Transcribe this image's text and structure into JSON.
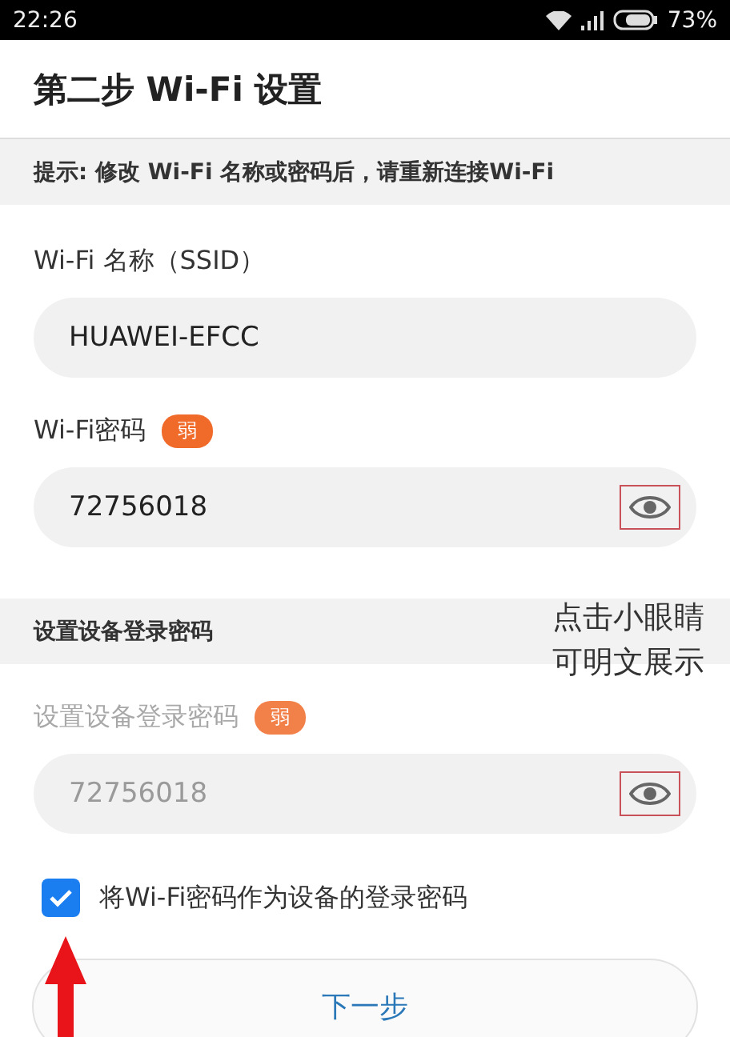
{
  "status_bar": {
    "time": "22:26",
    "battery": "73%"
  },
  "title": "第二步 Wi-Fi 设置",
  "hint": "提示: 修改 Wi-Fi 名称或密码后，请重新连接Wi-Fi",
  "wifi_fields": [
    {
      "kind": "text",
      "label": "Wi-Fi 名称（SSID）",
      "value": "HUAWEI-EFCC",
      "disabled": false
    },
    {
      "kind": "password",
      "label": "Wi-Fi密码",
      "badge": "弱",
      "value": "72756018",
      "disabled": false,
      "eye_highlighted": true
    }
  ],
  "login_section": {
    "title": "设置设备登录密码",
    "fields": [
      {
        "kind": "password",
        "label": "设置设备登录密码",
        "badge": "弱",
        "value": "72756018",
        "disabled": true,
        "eye_highlighted": true
      }
    ]
  },
  "annotation": {
    "lines": [
      "点击小眼睛",
      "可明文展示"
    ],
    "arrow": true
  },
  "checkbox": {
    "label": "将Wi-Fi密码作为设备的登录密码",
    "checked": true
  },
  "next_button": "下一步"
}
